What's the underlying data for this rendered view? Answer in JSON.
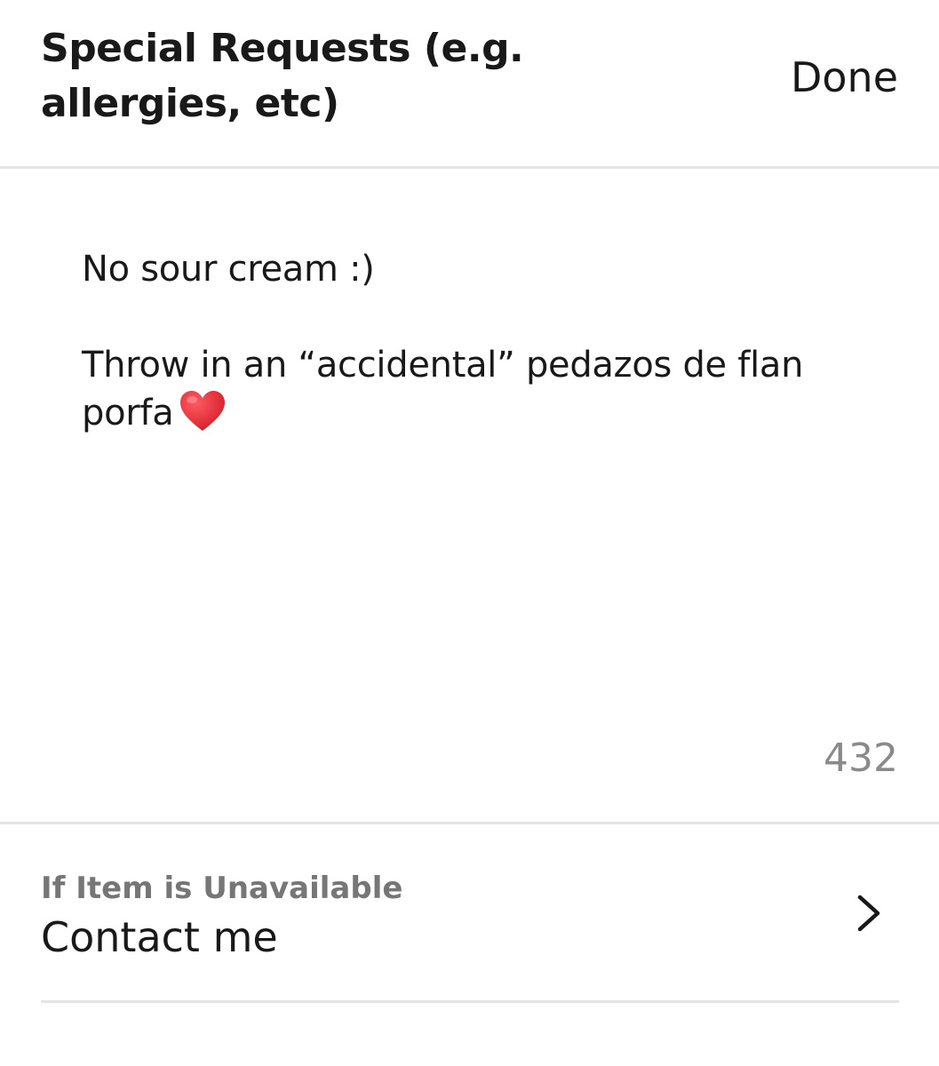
{
  "header": {
    "title": "Special Requests (e.g. allergies, etc)",
    "done_label": "Done"
  },
  "special_requests": {
    "line1": "No sour cream :)",
    "line2": "Throw in an “accidental” pedazos de flan",
    "line3": "porfa",
    "emoji_icon": "red-heart-icon",
    "char_count": "432"
  },
  "unavailable": {
    "label": "If Item is Unavailable",
    "value": "Contact me",
    "icon": "chevron-right-icon"
  },
  "colors": {
    "text": "#191919",
    "muted": "#767676",
    "counter": "#8a8a8a",
    "divider": "#e4e4e4",
    "heart": "#e0242f"
  }
}
